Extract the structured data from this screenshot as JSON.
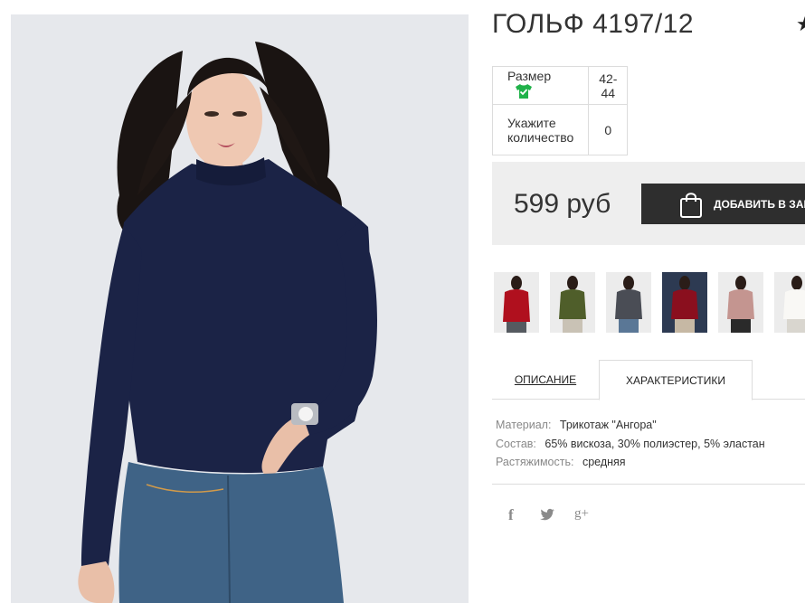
{
  "product": {
    "title": "ГОЛЬФ 4197/12",
    "favorite_icon": "star-icon"
  },
  "options": {
    "size_label": "Размер",
    "size_icon": "tshirt-check-icon",
    "size_value": "42-44",
    "qty_label_line1": "Укажите",
    "qty_label_line2": "количество",
    "qty_value": "0"
  },
  "buy": {
    "price": "599 руб",
    "add_label": "ДОБАВИТЬ В ЗАКАЗ",
    "bag_icon": "shopping-bag-icon"
  },
  "thumbnails": [
    {
      "color": "#b0101e",
      "name": "red"
    },
    {
      "color": "#4f5e2a",
      "name": "olive"
    },
    {
      "color": "#4a4d55",
      "name": "gray"
    },
    {
      "color": "#8a0f1e",
      "name": "burgundy"
    },
    {
      "color": "#c49590",
      "name": "pink"
    },
    {
      "color": "#f4f2ee",
      "name": "white"
    }
  ],
  "tabs": {
    "description": "ОПИСАНИЕ",
    "characteristics": "ХАРАКТЕРИСТИКИ"
  },
  "specs": {
    "material_label": "Материал:",
    "material_value": "Трикотаж \"Ангора\"",
    "composition_label": "Состав:",
    "composition_value": "65% вискоза, 30% полиэстер, 5% эластан",
    "stretch_label": "Растяжимость:",
    "stretch_value": "средняя"
  },
  "social": {
    "facebook": "f",
    "twitter": "twitter-icon",
    "googleplus": "g+"
  },
  "colors": {
    "button_bg": "#2e2e2e",
    "buy_box_bg": "#eeeeee",
    "size_icon": "#20b24a",
    "sweater": "#1b2346",
    "jeans": "#3f6386"
  }
}
